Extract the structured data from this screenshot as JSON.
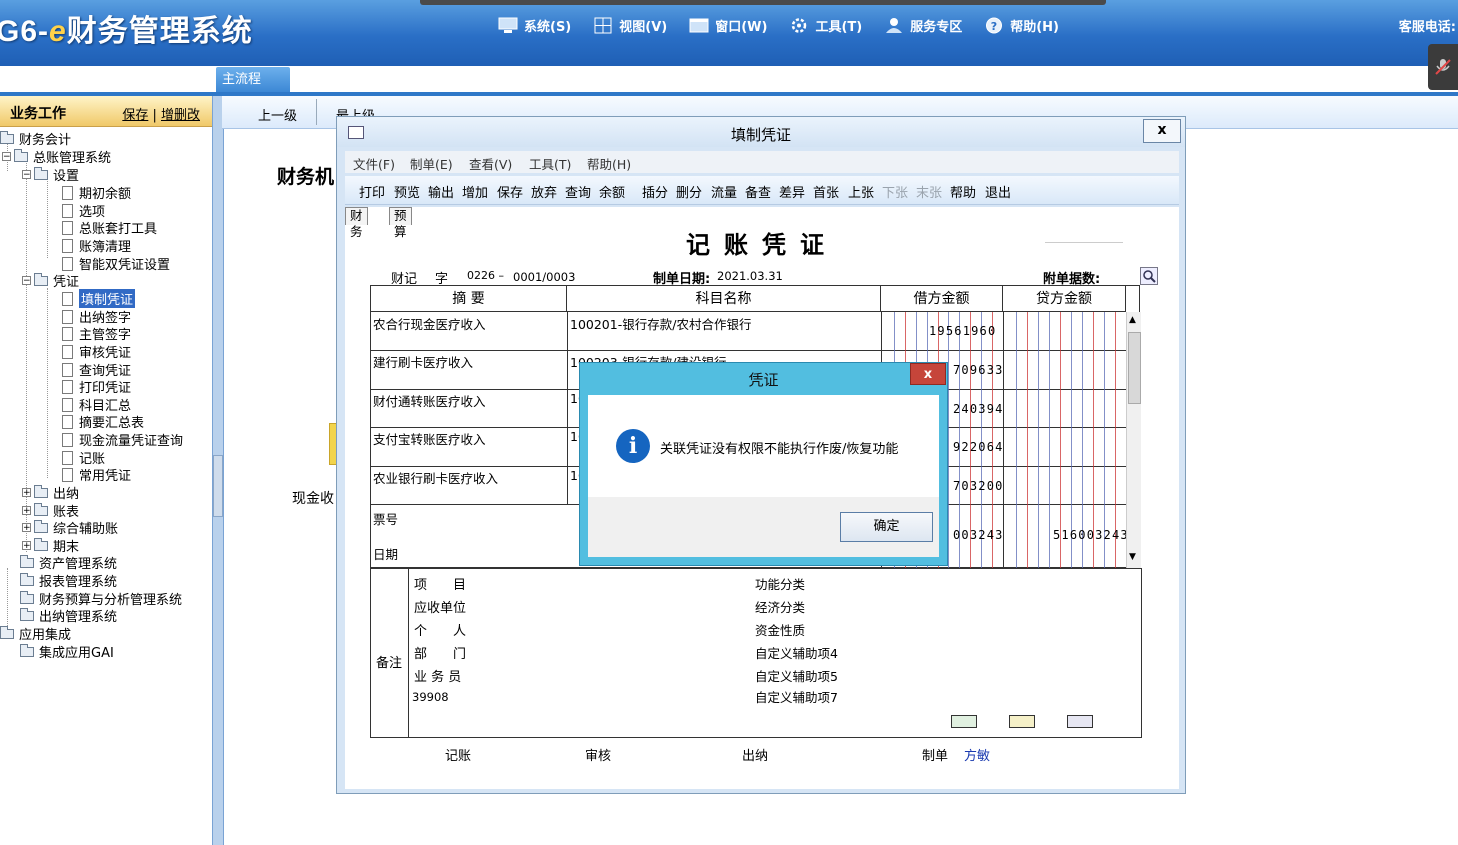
{
  "app": {
    "title_prefix": "G6-",
    "title_e": "e",
    "title_suffix": "财务管理系统",
    "hotline": "客服电话:"
  },
  "menu": [
    {
      "label": "系统(S)",
      "icon": "monitor-icon"
    },
    {
      "label": "视图(V)",
      "icon": "grid-icon"
    },
    {
      "label": "窗口(W)",
      "icon": "window-icon"
    },
    {
      "label": "工具(T)",
      "icon": "gear-icon"
    },
    {
      "label": "服务专区",
      "icon": "service-icon"
    },
    {
      "label": "帮助(H)",
      "icon": "help-icon"
    }
  ],
  "tab": {
    "main": "主流程"
  },
  "left": {
    "header": "业务工作",
    "save": "保存",
    "add_del": "增删改",
    "tree": [
      "财务会计",
      "总账管理系统",
      "设置",
      "期初余额",
      "选项",
      "总账套打工具",
      "账簿清理",
      "智能双凭证设置",
      "凭证",
      "填制凭证",
      "出纳签字",
      "主管签字",
      "审核凭证",
      "查询凭证",
      "打印凭证",
      "科目汇总",
      "摘要汇总表",
      "现金流量凭证查询",
      "记账",
      "常用凭证",
      "出纳",
      "账表",
      "综合辅助账",
      "期末",
      "资产管理系统",
      "报表管理系统",
      "财务预算与分析管理系统",
      "出纳管理系统",
      "应用集成",
      "集成应用GAI"
    ]
  },
  "nav": {
    "up": "上一级",
    "top": "最上级"
  },
  "background": {
    "title": "财务机",
    "cash": "现金收"
  },
  "voucher": {
    "window_title": "填制凭证",
    "menu": [
      "文件(F)",
      "制单(E)",
      "查看(V)",
      "工具(T)",
      "帮助(H)"
    ],
    "toolbar": [
      "打印",
      "预览",
      "输出",
      "增加",
      "保存",
      "放弃",
      "查询",
      "余额",
      "插分",
      "删分",
      "流量",
      "备查",
      "差异",
      "首张",
      "上张",
      "下张",
      "末张",
      "帮助",
      "退出"
    ],
    "subtabs": [
      "财务",
      "预算"
    ],
    "doc_title": "记账凭证",
    "type": "财记",
    "zi": "字",
    "no_a": "0226 –",
    "no_b": "0001/0003",
    "date_label": "制单日期:",
    "date": "2021.03.31",
    "attach_label": "附单据数:",
    "headers": [
      "摘 要",
      "科目名称",
      "借方金额",
      "贷方金额"
    ],
    "rows": [
      {
        "summary": "农合行现金医疗收入",
        "account": "100201-银行存款/农村合作银行",
        "debit": "19561960"
      },
      {
        "summary": "建行刷卡医疗收入",
        "account": "100203-银行存款/建设银行",
        "debit": "709633"
      },
      {
        "summary": "财付通转账医疗收入",
        "account": "10",
        "debit": "240394"
      },
      {
        "summary": "支付宝转账医疗收入",
        "account": "10",
        "debit": "922064"
      },
      {
        "summary": "农业银行刷卡医疗收入",
        "account": "10",
        "debit": "703200"
      }
    ],
    "ticket_label": "票号",
    "date_row_label": "日期",
    "total_debit": "003243",
    "total_credit": "516003243",
    "remarks_label": "备注",
    "remarks_left": [
      "项　　目",
      "应收单位",
      "个　　人",
      "部　　门",
      "业 务 员",
      "39908"
    ],
    "remarks_right": [
      "功能分类",
      "经济分类",
      "资金性质",
      "自定义辅助项4",
      "自定义辅助项5",
      "自定义辅助项7"
    ],
    "signs": {
      "post": "记账",
      "audit": "审核",
      "cashier": "出纳",
      "maker_label": "制单",
      "maker": "方敏"
    }
  },
  "dialog": {
    "title": "凭证",
    "close": "x",
    "message": "关联凭证没有权限不能执行作废/恢复功能",
    "ok": "确定"
  },
  "colors": {
    "accent": "#2a6fc6",
    "dialog": "#52bee0",
    "selection": "#316ac5",
    "close_red": "#c6453a"
  }
}
